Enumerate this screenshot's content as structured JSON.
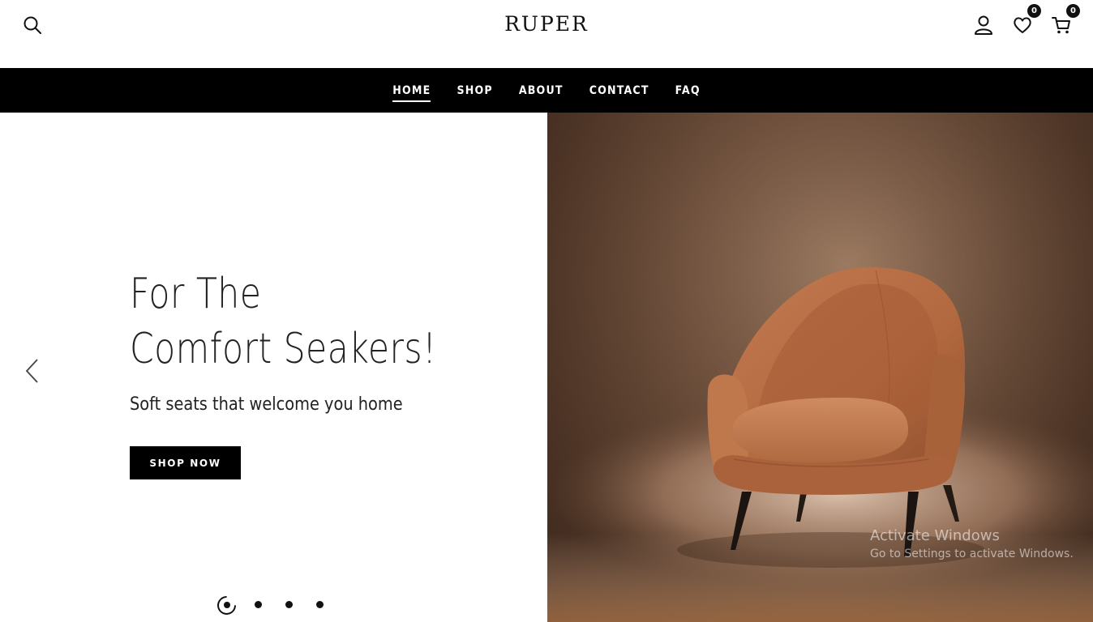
{
  "header": {
    "logo": "RUPER",
    "wishlist_count": "0",
    "cart_count": "0",
    "icons": [
      "search-icon",
      "user-icon",
      "heart-icon",
      "cart-icon"
    ]
  },
  "nav": {
    "items": [
      {
        "label": "HOME",
        "active": true
      },
      {
        "label": "SHOP",
        "active": false
      },
      {
        "label": "ABOUT",
        "active": false
      },
      {
        "label": "CONTACT",
        "active": false
      },
      {
        "label": "FAQ",
        "active": false
      }
    ]
  },
  "hero": {
    "title_line1": "For The",
    "title_line2": "Comfort Seakers!",
    "subtitle": "Soft seats that welcome you home",
    "button_label": "SHOP NOW",
    "slide_count": 4,
    "active_slide": 1
  },
  "watermark": {
    "line1": "Activate Windows",
    "line2": "Go to Settings to activate Windows."
  },
  "colors": {
    "nav_bg": "#000000",
    "chair": "#b9714a",
    "backdrop": "#6e4f3b"
  }
}
